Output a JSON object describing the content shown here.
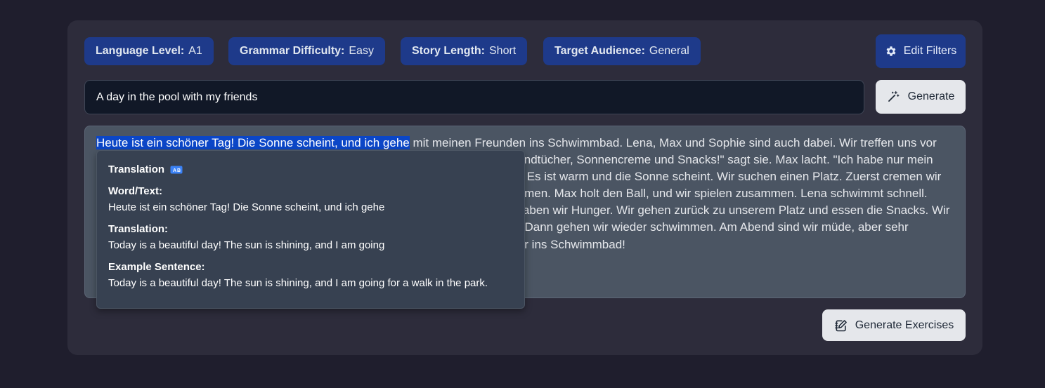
{
  "filters": [
    {
      "key": "Language Level:",
      "value": "A1"
    },
    {
      "key": "Grammar Difficulty:",
      "value": "Easy"
    },
    {
      "key": "Story Length:",
      "value": "Short"
    },
    {
      "key": "Target Audience:",
      "value": "General"
    }
  ],
  "edit_filters": {
    "label": "Edit Filters",
    "icon": "gear-icon"
  },
  "prompt": {
    "value": "A day in the pool with my friends"
  },
  "generate": {
    "label": "Generate",
    "icon": "magic-wand-icon"
  },
  "story": {
    "highlighted": "Heute ist ein schöner Tag! Die Sonne scheint, und ich gehe",
    "rest": " mit meinen Freunden ins Schwimmbad. Lena, Max und Sophie sind auch dabei. Wir treffen uns vor dem Eingang. Lena hat eine große Tasche. \"Was hast du da drin?\" frage ich. \"Handtücher, Sonnencreme und Snacks!\" sagt sie. Max lacht. \"Ich habe nur mein Handtuch\", sagt er. Sophie hat ihre neue Schwimmbrille dabei. Wir gehen hinein. Es ist warm und die Sonne scheint. Wir suchen einen Platz. Zuerst cremen wir uns ein. Dann gehen wir ins Wasser. Das Wasser ist kalt! Wir lachen und schwimmen. Max holt den Ball, und wir spielen zusammen. Lena schwimmt schnell. Sophie taucht unter Wasser. Wir haben viel Spaß im Wasser. Nach einer Weile haben wir Hunger. Wir gehen zurück zu unserem Platz und essen die Snacks. Wir essen Brot und Obst, wir lachen und reden. Nach dem Essen ruhen wir uns aus. Dann gehen wir wieder schwimmen. Am Abend sind wir müde, aber sehr glücklich. Wir sagen \"Tschüss!\" und gehen nach Hause. Morgen gehen wir wieder ins Schwimmbad!"
  },
  "popup": {
    "title": "Translation",
    "title_icon": "translate-icon",
    "word_label": "Word/Text:",
    "word_value": "Heute ist ein schöner Tag! Die Sonne scheint, und ich gehe",
    "translation_label": "Translation:",
    "translation_value": "Today is a beautiful day! The sun is shining, and I am going",
    "example_label": "Example Sentence:",
    "example_value": "Today is a beautiful day! The sun is shining, and I am going for a walk in the park."
  },
  "exercises": {
    "label": "Generate Exercises",
    "icon": "notebook-edit-icon"
  }
}
